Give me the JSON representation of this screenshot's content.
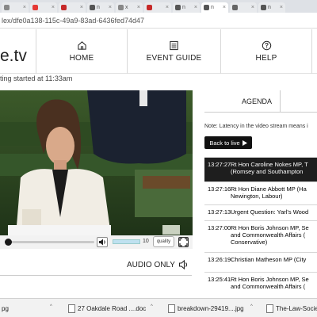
{
  "browser": {
    "tabs": [
      {
        "label": "",
        "color": "#888888"
      },
      {
        "label": "",
        "color": "#e53935"
      },
      {
        "label": "",
        "color": "#c62828"
      },
      {
        "label": "n",
        "color": "#555555"
      },
      {
        "label": "x",
        "color": "#888888"
      },
      {
        "label": "",
        "color": "#c62828"
      },
      {
        "label": "n",
        "color": "#555555"
      },
      {
        "label": "n",
        "color": "#555555"
      },
      {
        "label": "",
        "color": "#666666"
      },
      {
        "label": "n",
        "color": "#555555"
      }
    ],
    "url": "lex/dfe0a138-115c-49a9-83ad-6436fed74d47"
  },
  "site": {
    "logo": "e.tv",
    "nav": [
      {
        "label": "HOME",
        "icon": "home-icon"
      },
      {
        "label": "EVENT GUIDE",
        "icon": "event-guide-icon"
      },
      {
        "label": "HELP",
        "icon": "help-icon"
      }
    ]
  },
  "player": {
    "status_line": "ting started at 11:33am",
    "volume_value": "10",
    "quality_label": "quality",
    "audio_only_label": "AUDIO ONLY"
  },
  "agenda": {
    "tab_label": "AGENDA",
    "note": "Note: Latency in the video stream means i",
    "back_to_live": "Back to live",
    "items": [
      {
        "time": "13:27:27",
        "desc": "Rt Hon Caroline Nokes MP, T (Romsey and Southampton",
        "active": true
      },
      {
        "time": "13:27:16",
        "desc": "Rt Hon Diane Abbott MP (Ha Newington, Labour)",
        "active": false
      },
      {
        "time": "13:27:13",
        "desc": "Urgent Question: Yarl's Wood",
        "active": false
      },
      {
        "time": "13:27:00",
        "desc": "Rt Hon Boris Johnson MP, Se and Commonwealth Affairs ( Conservative)",
        "active": false
      },
      {
        "time": "13:26:19",
        "desc": "Christian Matheson MP (City",
        "active": false
      },
      {
        "time": "13:25:41",
        "desc": "Rt Hon Boris Johnson MP, Se and Commonwealth Affairs (",
        "active": false
      }
    ]
  },
  "taskbar": {
    "downloads": [
      {
        "name": "pg"
      },
      {
        "name": "27 Oakdale Road ....doc"
      },
      {
        "name": "breakdown-29419....jpg"
      },
      {
        "name": "The-Law-Societ"
      }
    ]
  }
}
